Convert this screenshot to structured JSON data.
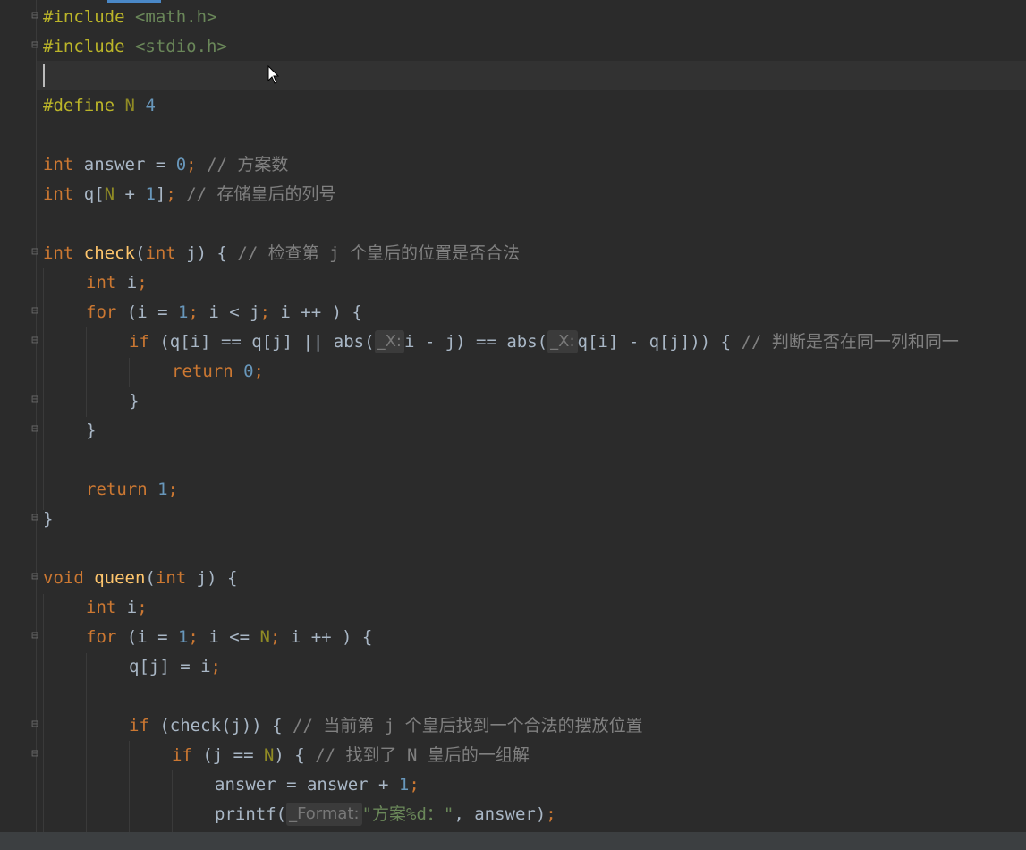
{
  "code": {
    "l1": {
      "a": "#include",
      "b": "<math.h>"
    },
    "l2": {
      "a": "#include",
      "b": "<stdio.h>"
    },
    "l4": {
      "a": "#define",
      "b": "N",
      "c": "4"
    },
    "l6": {
      "a": "int",
      "b": " answer = ",
      "c": "0",
      "d": ";",
      "e": " // 方案数"
    },
    "l7": {
      "a": "int",
      "b": " q[",
      "c": "N",
      "d": " + ",
      "e": "1",
      "f": "]",
      "g": ";",
      "h": " // 存储皇后的列号"
    },
    "l9": {
      "a": "int",
      "b": "check",
      "c": "(",
      "d": "int",
      "e": " j) { ",
      "f": "// 检查第 j 个皇后的位置是否合法"
    },
    "l10": {
      "a": "int",
      "b": " i",
      "c": ";"
    },
    "l11": {
      "a": "for",
      "b": " (i = ",
      "c": "1",
      "d": ";",
      "e": " i < j",
      "f": ";",
      "g": " i ++ ) {"
    },
    "l12": {
      "a": "if",
      "b": " (q[i] == q[j] || abs(",
      "hint1": "_X:",
      "c": "i - j) == abs(",
      "hint2": "_X:",
      "d": "q[i] - q[j])) { ",
      "e": "// 判断是否在同一列和同一"
    },
    "l13": {
      "a": "return",
      "b": "0",
      "c": ";"
    },
    "l14": {
      "a": "}"
    },
    "l15": {
      "a": "}"
    },
    "l17": {
      "a": "return",
      "b": "1",
      "c": ";"
    },
    "l18": {
      "a": "}"
    },
    "l20": {
      "a": "void",
      "b": "queen",
      "c": "(",
      "d": "int",
      "e": " j) {"
    },
    "l21": {
      "a": "int",
      "b": " i",
      "c": ";"
    },
    "l22": {
      "a": "for",
      "b": " (i = ",
      "c": "1",
      "d": ";",
      "e": " i <= ",
      "f": "N",
      "g": ";",
      "h": " i ++ ) {"
    },
    "l23": {
      "a": "q[j] = i",
      "b": ";"
    },
    "l25": {
      "a": "if",
      "b": " (check(j)) { ",
      "c": "// 当前第 j 个皇后找到一个合法的摆放位置"
    },
    "l26": {
      "a": "if",
      "b": " (j == ",
      "c": "N",
      "d": ") { ",
      "e": "// 找到了 N 皇后的一组解"
    },
    "l27": {
      "a": "answer = answer + ",
      "b": "1",
      "c": ";"
    },
    "l28": {
      "a": "printf(",
      "hint": "_Format:",
      "b": "\"方案%d：\"",
      "c": ", answer)",
      "d": ";"
    }
  },
  "icons": {
    "fold": "fold-marker-icon",
    "pointer": "mouse-pointer-icon"
  },
  "colors": {
    "background": "#2b2b2b",
    "keyword": "#cc7832",
    "function": "#ffc66d",
    "number": "#6897bb",
    "comment": "#808080",
    "string": "#6a8759",
    "preprocessor": "#bbb529"
  }
}
